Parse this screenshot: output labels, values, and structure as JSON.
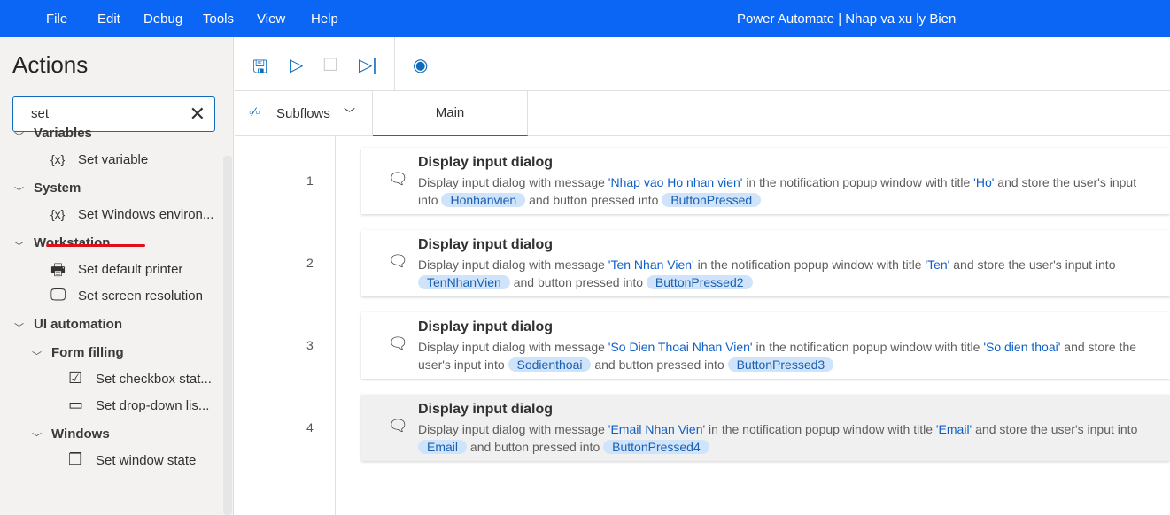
{
  "menu": [
    "File",
    "Edit",
    "Debug",
    "Tools",
    "View",
    "Help"
  ],
  "app_title": "Power Automate | Nhap va xu ly Bien",
  "sidebar": {
    "title": "Actions",
    "search_value": "set",
    "tree": [
      {
        "label": "Variables",
        "level": 0
      },
      {
        "label": "Set variable",
        "level": 1,
        "icon": "variable-icon",
        "glyph": "{x}"
      },
      {
        "label": "System",
        "level": 0
      },
      {
        "label": "Set Windows environ...",
        "level": 1,
        "icon": "variable-icon",
        "glyph": "{x}"
      },
      {
        "label": "Workstation",
        "level": 0
      },
      {
        "label": "Set default printer",
        "level": 1,
        "icon": "printer-icon",
        "glyph": "🖶"
      },
      {
        "label": "Set screen resolution",
        "level": 1,
        "icon": "monitor-icon",
        "glyph": "🖵"
      },
      {
        "label": "UI automation",
        "level": 0
      },
      {
        "label": "Form filling",
        "level": 1,
        "group": true
      },
      {
        "label": "Set checkbox stat...",
        "level": 2,
        "icon": "checkbox-icon",
        "glyph": "☑"
      },
      {
        "label": "Set drop-down lis...",
        "level": 2,
        "icon": "dropdown-icon",
        "glyph": "▭"
      },
      {
        "label": "Windows",
        "level": 1,
        "group": true
      },
      {
        "label": "Set window state",
        "level": 2,
        "icon": "window-icon",
        "glyph": "❐"
      }
    ]
  },
  "toolbar": {
    "icons": [
      "save-icon",
      "run-icon",
      "stop-icon",
      "step-icon",
      "record-icon"
    ]
  },
  "tabs": {
    "subflows": "Subflows",
    "main": "Main"
  },
  "accent": "#0b66f6",
  "actions": [
    {
      "num": "1",
      "title": "Display input dialog",
      "parts": [
        [
          "t",
          "Display input dialog with message "
        ],
        [
          "s",
          "'Nhap vao Ho nhan vien'"
        ],
        [
          "t",
          " in the notification popup window with title "
        ],
        [
          "s",
          "'Ho'"
        ],
        [
          "t",
          " and store the user's input into "
        ],
        [
          "v",
          "Honhanvien"
        ],
        [
          "t",
          " and button pressed into "
        ],
        [
          "v",
          "ButtonPressed"
        ]
      ]
    },
    {
      "num": "2",
      "title": "Display input dialog",
      "parts": [
        [
          "t",
          "Display input dialog with message "
        ],
        [
          "s",
          "'Ten Nhan Vien'"
        ],
        [
          "t",
          " in the notification popup window with title "
        ],
        [
          "s",
          "'Ten'"
        ],
        [
          "t",
          " and store the user's input into "
        ],
        [
          "v",
          "TenNhanVien"
        ],
        [
          "t",
          " and button pressed into "
        ],
        [
          "v",
          "ButtonPressed2"
        ]
      ]
    },
    {
      "num": "3",
      "title": "Display input dialog",
      "parts": [
        [
          "t",
          "Display input dialog with message "
        ],
        [
          "s",
          "'So Dien Thoai Nhan Vien'"
        ],
        [
          "t",
          " in the notification popup window with title "
        ],
        [
          "s",
          "'So dien thoai'"
        ],
        [
          "t",
          " and store the user's input into "
        ],
        [
          "v",
          "Sodienthoai"
        ],
        [
          "t",
          " and button pressed into "
        ],
        [
          "v",
          "ButtonPressed3"
        ]
      ]
    },
    {
      "num": "4",
      "title": "Display input dialog",
      "selected": true,
      "parts": [
        [
          "t",
          "Display input dialog with message "
        ],
        [
          "s",
          "'Email Nhan Vien'"
        ],
        [
          "t",
          " in the notification popup window with title "
        ],
        [
          "s",
          "'Email'"
        ],
        [
          "t",
          " and store the user's input into "
        ],
        [
          "v",
          "Email"
        ],
        [
          "t",
          " and button pressed into "
        ],
        [
          "v",
          "ButtonPressed4"
        ]
      ]
    }
  ]
}
